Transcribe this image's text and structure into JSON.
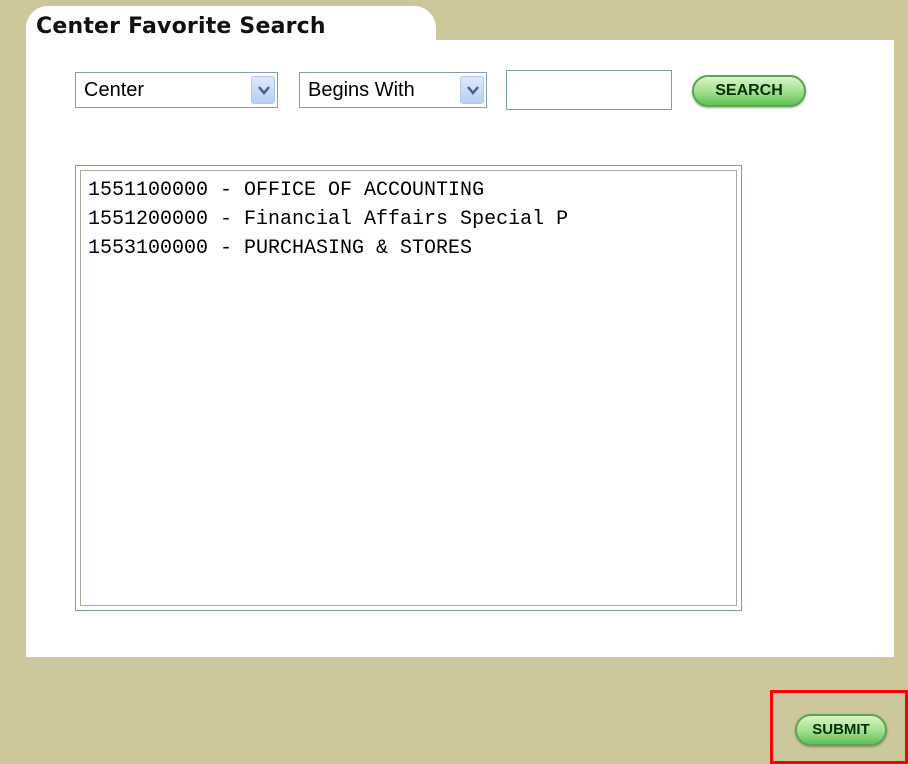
{
  "header": {
    "title": "Center Favorite Search"
  },
  "search": {
    "field_select": "Center",
    "operator_select": "Begins With",
    "query_value": "",
    "search_button": "SEARCH"
  },
  "results": {
    "items": [
      "1551100000 - OFFICE OF ACCOUNTING",
      "1551200000 - Financial Affairs Special P",
      "1553100000 - PURCHASING & STORES"
    ]
  },
  "footer": {
    "submit_button": "SUBMIT"
  },
  "colors": {
    "background": "#ccc89b",
    "panel": "#ffffff",
    "button_green": "#9fdf8c",
    "highlight_red": "#ff0000",
    "input_border": "#7f9db9"
  },
  "icons": {
    "dropdown": "chevron-down-icon"
  }
}
